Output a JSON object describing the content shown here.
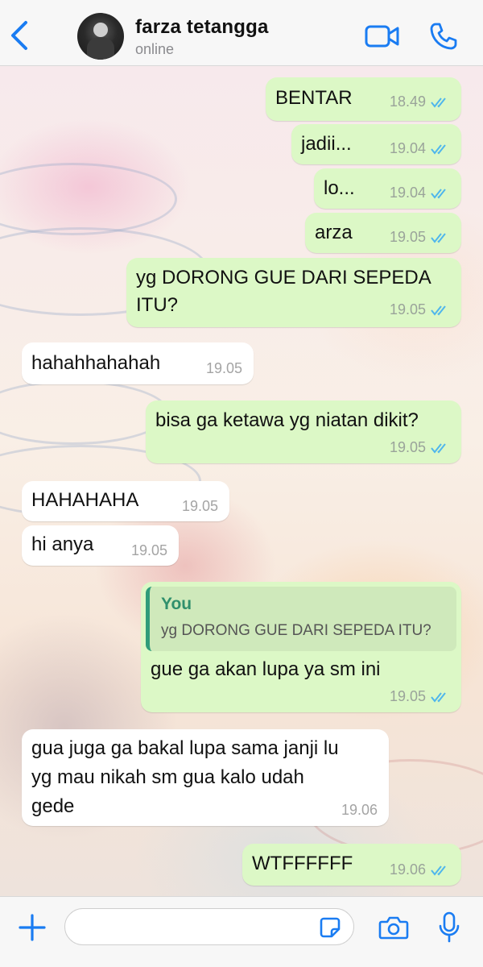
{
  "header": {
    "contact_name": "farza tetangga",
    "status": "online",
    "accent_color": "#1a7cf2"
  },
  "messages": [
    {
      "dir": "out",
      "text": "BENTAR",
      "time": "18.49",
      "read": true
    },
    {
      "dir": "out",
      "text": "jadii...",
      "time": "19.04",
      "read": true
    },
    {
      "dir": "out",
      "text": "lo...",
      "time": "19.04",
      "read": true
    },
    {
      "dir": "out",
      "text": "arza",
      "time": "19.05",
      "read": true
    },
    {
      "dir": "out",
      "lines": [
        "yg DORONG GUE DARI SEPEDA",
        "ITU?"
      ],
      "time": "19.05",
      "read": true
    },
    {
      "dir": "in",
      "text": "hahahhahahah",
      "time": "19.05"
    },
    {
      "dir": "out",
      "text": "bisa ga ketawa yg niatan dikit?",
      "time": "19.05",
      "read": true
    },
    {
      "dir": "in",
      "text": "HAHAHAHA",
      "time": "19.05"
    },
    {
      "dir": "in",
      "text": "hi anya",
      "time": "19.05"
    },
    {
      "dir": "out",
      "reply_to": {
        "author": "You",
        "text": "yg DORONG GUE DARI SEPEDA ITU?"
      },
      "text": "gue ga akan lupa ya sm ini",
      "time": "19.05",
      "read": true
    },
    {
      "dir": "in",
      "lines": [
        "gua juga ga bakal lupa sama janji lu",
        "yg mau nikah sm gua kalo udah",
        "gede"
      ],
      "time": "19.06"
    },
    {
      "dir": "out",
      "text": "WTFFFFFF",
      "time": "19.06",
      "read": true
    }
  ],
  "composer": {
    "placeholder": "",
    "icons": [
      "plus-icon",
      "sticker-icon",
      "camera-icon",
      "microphone-icon"
    ]
  },
  "colors": {
    "outgoing_bubble": "#dcf8c6",
    "incoming_bubble": "#ffffff",
    "read_tick": "#4fb6ec"
  }
}
